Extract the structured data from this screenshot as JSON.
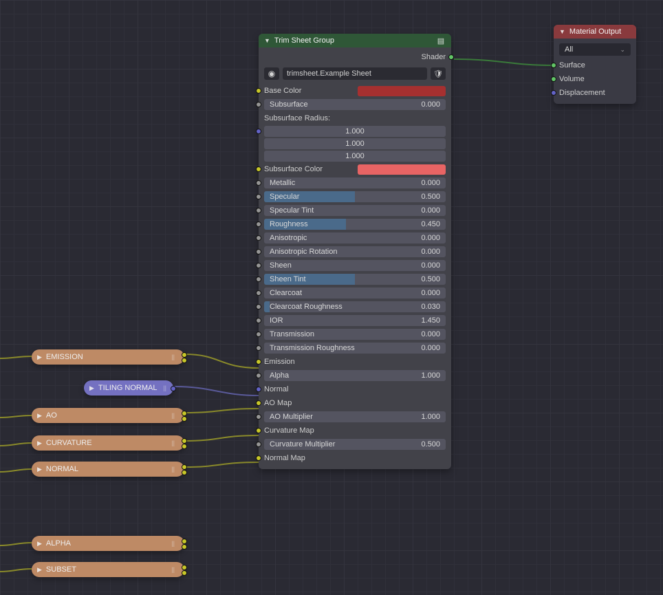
{
  "trim": {
    "title": "Trim Sheet Group",
    "id_text": "trimsheet.Example Sheet",
    "output_label": "Shader",
    "base_color_label": "Base Color",
    "base_color_hex": "#a63030",
    "subsurface_label": "Subsurface",
    "subsurface_value": "0.000",
    "subsurface_radius_label": "Subsurface Radius:",
    "subsurface_radius": [
      "1.000",
      "1.000",
      "1.000"
    ],
    "subsurface_color_label": "Subsurface Color",
    "subsurface_color_hex": "#e86464",
    "params": [
      {
        "label": "Metallic",
        "value": "0.000",
        "pct": 0
      },
      {
        "label": "Specular",
        "value": "0.500",
        "pct": 50
      },
      {
        "label": "Specular Tint",
        "value": "0.000",
        "pct": 0
      },
      {
        "label": "Roughness",
        "value": "0.450",
        "pct": 45
      },
      {
        "label": "Anisotropic",
        "value": "0.000",
        "pct": 0
      },
      {
        "label": "Anisotropic Rotation",
        "value": "0.000",
        "pct": 0
      },
      {
        "label": "Sheen",
        "value": "0.000",
        "pct": 0
      },
      {
        "label": "Sheen Tint",
        "value": "0.500",
        "pct": 50
      },
      {
        "label": "Clearcoat",
        "value": "0.000",
        "pct": 0
      },
      {
        "label": "Clearcoat Roughness",
        "value": "0.030",
        "pct": 3
      },
      {
        "label": "IOR",
        "value": "1.450",
        "pct": 0,
        "flat": true
      },
      {
        "label": "Transmission",
        "value": "0.000",
        "pct": 0
      },
      {
        "label": "Transmission Roughness",
        "value": "0.000",
        "pct": 0
      }
    ],
    "emission_label": "Emission",
    "alpha_label": "Alpha",
    "alpha_value": "1.000",
    "normal_label": "Normal",
    "ao_map_label": "AO Map",
    "ao_mult_label": "AO Multiplier",
    "ao_mult_value": "1.000",
    "curv_map_label": "Curvature Map",
    "curv_mult_label": "Curvature Multiplier",
    "curv_mult_value": "0.500",
    "normal_map_label": "Normal Map"
  },
  "mat": {
    "title": "Material Output",
    "select": "All",
    "surface": "Surface",
    "volume": "Volume",
    "displacement": "Displacement"
  },
  "collapsed": {
    "emission": "EMISSION",
    "tiling_normal": "TILING NORMAL",
    "ao": "AO",
    "curvature": "CURVATURE",
    "normal": "NORMAL",
    "alpha": "ALPHA",
    "subset": "SUBSET"
  }
}
